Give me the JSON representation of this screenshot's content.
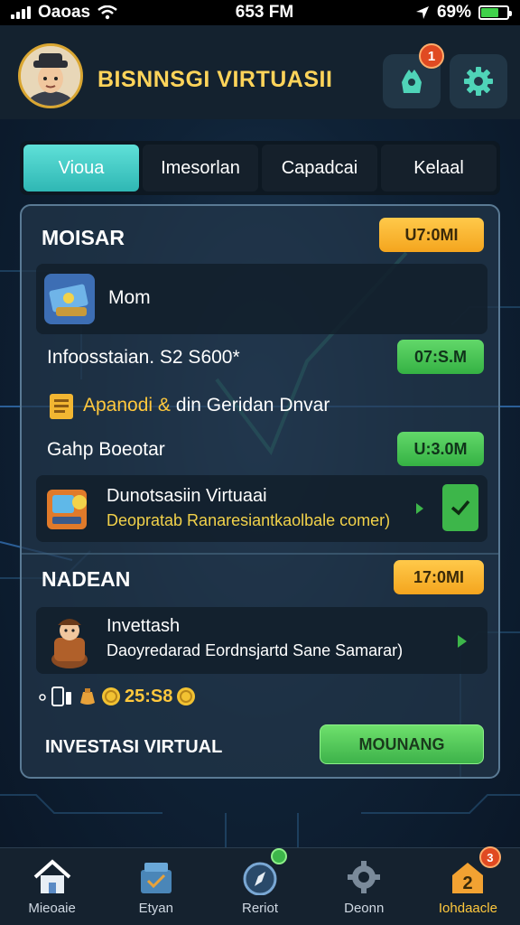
{
  "status_bar": {
    "carrier": "Oaoas",
    "time": "653 FM",
    "battery": "69%",
    "battery_level": 0.69
  },
  "header": {
    "title": "BISNNSGI VIRTUASII",
    "notification_count": "1"
  },
  "tabs": [
    {
      "label": "Vioua",
      "active": true
    },
    {
      "label": "Imesorlan",
      "active": false
    },
    {
      "label": "Capadcai",
      "active": false
    },
    {
      "label": "Kelaal",
      "active": false
    }
  ],
  "section1": {
    "title": "MOISAR",
    "badge": "U7:0MI",
    "card1_label": "Mom",
    "row1_text": "Infoosstaian. S2 S600*",
    "row1_pill": "07:S.M",
    "row2_text_highlight": "Apanodi &",
    "row2_text_rest": " din Geridan Dnvar",
    "row3_text": "Gahp Boeotar",
    "row3_pill": "U:3.0M",
    "card2_title": "Dunotsasiin Virtuaai",
    "card2_subtitle": "Deopratab Ranaresiantkaolbale comer)"
  },
  "section2": {
    "title": "NADEAN",
    "badge": "17:0MI",
    "card_title": "Invettash",
    "card_subtitle": "Daoyredarad Eordnsjartd Sane Samarar)",
    "coins_text": "25:S8",
    "footer_label": "INVESTASI VIRTUAL",
    "cta_label": "MOUNANG"
  },
  "bottom_nav": [
    {
      "label": "Mieoaie",
      "icon": "home-icon",
      "active": false
    },
    {
      "label": "Etyan",
      "icon": "shop-icon",
      "active": false
    },
    {
      "label": "Reriot",
      "icon": "compass-icon",
      "active": false
    },
    {
      "label": "Deonn",
      "icon": "gear-icon",
      "active": false
    },
    {
      "label": "Iohdaacle",
      "icon": "trophy-icon",
      "active": true,
      "badge": "3"
    }
  ],
  "colors": {
    "accent_teal": "#3fc9c4",
    "accent_gold": "#ffc83d",
    "accent_green": "#3db64a",
    "badge_orange": "#f4a51e"
  }
}
